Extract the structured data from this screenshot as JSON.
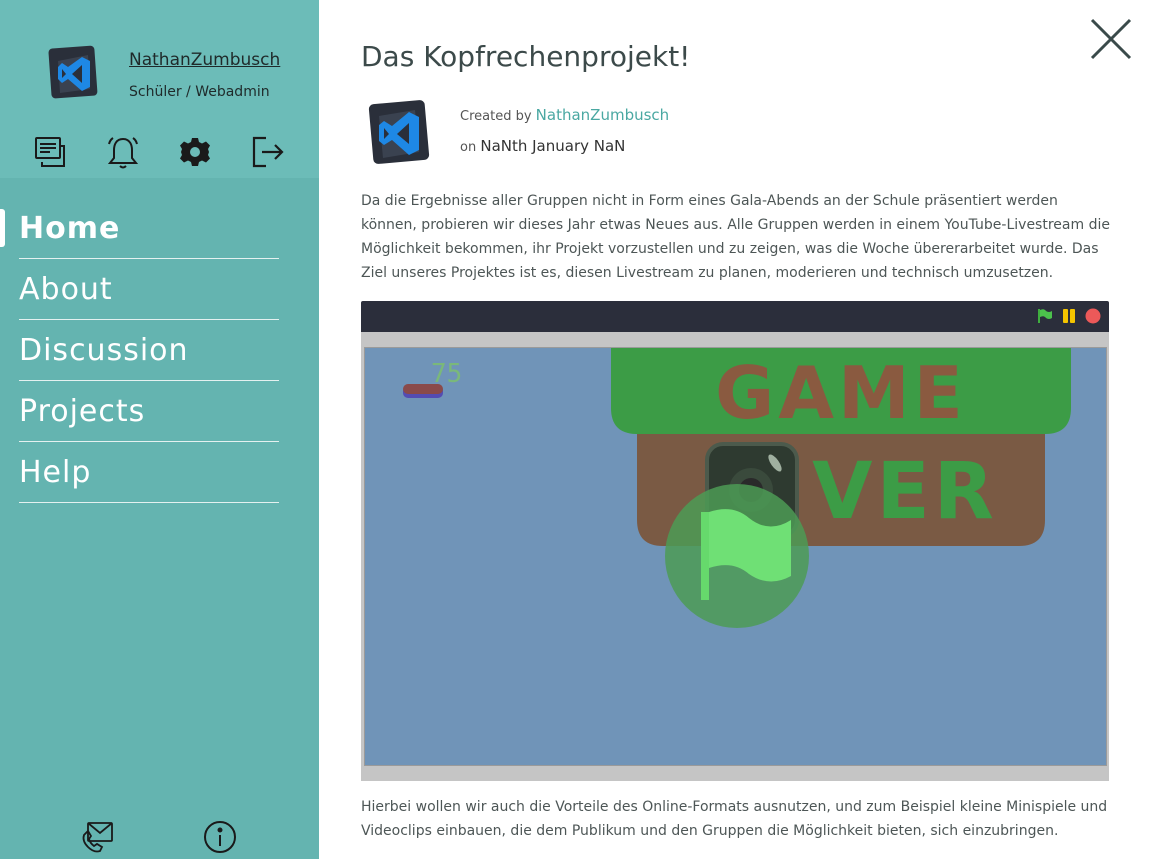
{
  "user": {
    "name": "NathanZumbusch",
    "role": "Schüler / Webadmin"
  },
  "top_icons": [
    "chat-icon",
    "bell-icon",
    "gear-icon",
    "logout-icon"
  ],
  "nav": {
    "items": [
      {
        "label": "Home",
        "active": true
      },
      {
        "label": "About",
        "active": false
      },
      {
        "label": "Discussion",
        "active": false
      },
      {
        "label": "Projects",
        "active": false
      },
      {
        "label": "Help",
        "active": false
      }
    ]
  },
  "bottom_icons": [
    "mail-phone-icon",
    "info-icon"
  ],
  "project": {
    "title": "Das Kopfrechenprojekt!",
    "created_by_label": "Created by",
    "author": "NathanZumbusch",
    "on_label": "on",
    "date": "NaNth January NaN",
    "description": "Da die Ergebnisse aller Gruppen nicht in Form eines Gala-Abends an der Schule präsentiert werden können, probieren wir dieses Jahr etwas Neues aus. Alle Gruppen werden in einem YouTube-Livestream die Möglichkeit bekommen, ihr Projekt vorzustellen und zu zeigen, was die Woche übererarbeitet wurde. Das Ziel unseres Projektes ist es, diesen Livestream zu planen, moderieren und technisch umzusetzen.",
    "description2": "Hierbei wollen wir auch die Vorteile des Online-Formats ausnutzen, und zum Beispiel kleine Minispiele und Videoclips einbauen, die dem Publikum und den Gruppen die Möglichkeit bieten, sich einzubringen."
  },
  "player": {
    "score": "75",
    "game_over_line1": "GAME",
    "game_over_line2": "VER",
    "controls": [
      "green-flag-icon",
      "pause-icon",
      "stop-icon"
    ]
  },
  "colors": {
    "sidebar": "#64b4b0",
    "accent": "#4aa8a2",
    "stage_bg": "#7094b8"
  }
}
